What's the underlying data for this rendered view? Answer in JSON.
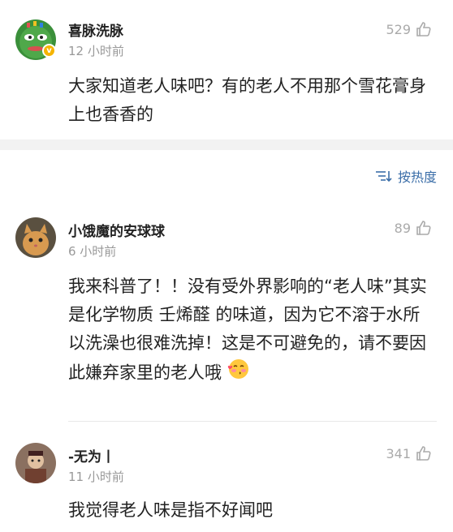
{
  "comments": [
    {
      "username": "喜脉洗脉",
      "time": "12 小时前",
      "likes": "529",
      "text": "大家知道老人味吧？有的老人不用那个雪花膏身上也香香的",
      "verified_badge": "v"
    },
    {
      "username": "小饿魔的安球球",
      "time": "6 小时前",
      "likes": "89",
      "text": "我来科普了！！没有受外界影响的“老人味”其实是化学物质 壬烯醛 的味道，因为它不溶于水所以洗澡也很难洗掉！这是不可避免的，请不要因此嫌弃家里的老人哦",
      "emoji": "blush-kiss-emoji"
    },
    {
      "username": "-无为丨",
      "time": "11 小时前",
      "likes": "341",
      "text": "我觉得老人味是指不好闻吧"
    }
  ],
  "sort": {
    "label": "按热度",
    "icon": "sort-icon"
  },
  "colors": {
    "link": "#3b6ea8",
    "muted": "#999999",
    "band": "#f2f2f2"
  }
}
